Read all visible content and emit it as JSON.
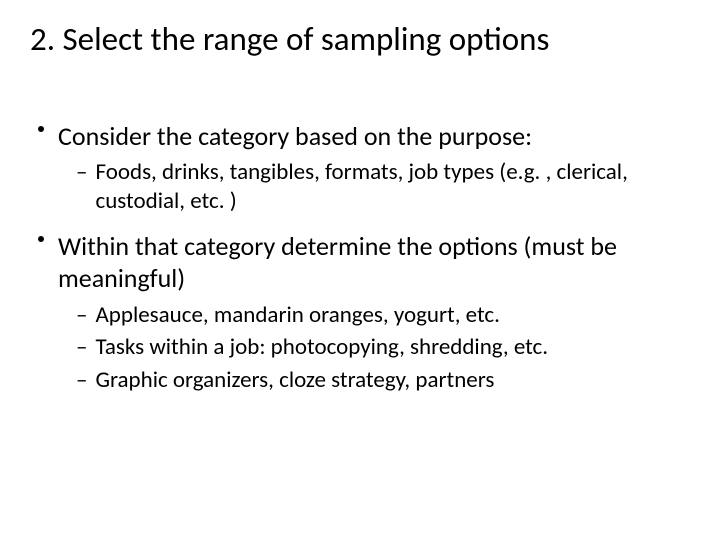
{
  "slide": {
    "title": "2. Select the range of sampling options",
    "bullets": [
      {
        "text": "Consider the category based on the purpose:",
        "subs": [
          "Foods, drinks, tangibles, formats, job types (e.g. , clerical, custodial, etc. )"
        ]
      },
      {
        "text": "Within that category determine the options (must be meaningful)",
        "subs": [
          "Applesauce, mandarin oranges, yogurt, etc.",
          "Tasks within a job: photocopying, shredding, etc.",
          "Graphic organizers, cloze strategy, partners"
        ]
      }
    ]
  }
}
